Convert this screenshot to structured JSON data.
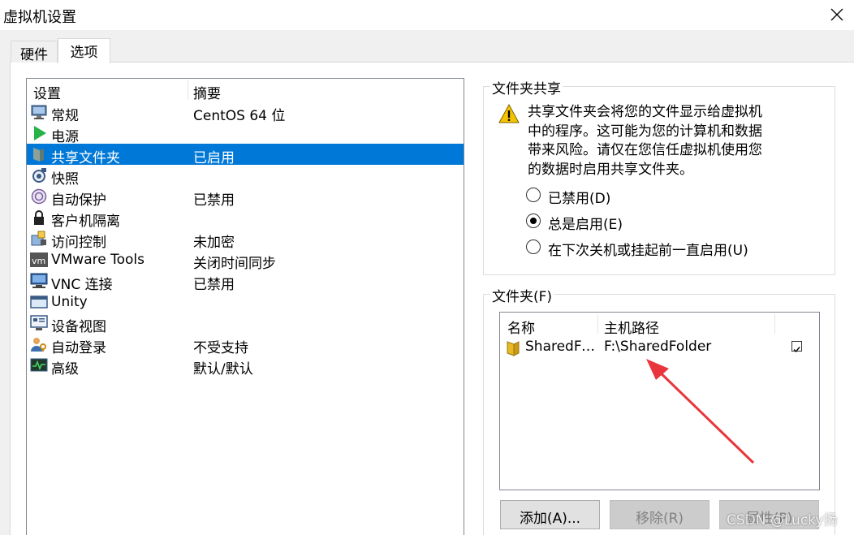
{
  "window": {
    "title": "虚拟机设置"
  },
  "tabs": [
    {
      "label": "硬件"
    },
    {
      "label": "选项"
    }
  ],
  "list": {
    "headers": {
      "setting": "设置",
      "summary": "摘要"
    },
    "items": [
      {
        "name": "常规",
        "summary": "CentOS 64 位",
        "icon": "monitor-icon"
      },
      {
        "name": "电源",
        "summary": "",
        "icon": "play-icon"
      },
      {
        "name": "共享文件夹",
        "summary": "已启用",
        "icon": "shared-folder-icon",
        "selected": true
      },
      {
        "name": "快照",
        "summary": "",
        "icon": "snapshot-icon"
      },
      {
        "name": "自动保护",
        "summary": "已禁用",
        "icon": "autoprotect-icon"
      },
      {
        "name": "客户机隔离",
        "summary": "",
        "icon": "lock-icon"
      },
      {
        "name": "访问控制",
        "summary": "未加密",
        "icon": "access-control-icon"
      },
      {
        "name": "VMware Tools",
        "summary": "关闭时间同步",
        "icon": "vmware-tools-icon"
      },
      {
        "name": "VNC 连接",
        "summary": "已禁用",
        "icon": "vnc-icon"
      },
      {
        "name": "Unity",
        "summary": "",
        "icon": "unity-icon"
      },
      {
        "name": "设备视图",
        "summary": "",
        "icon": "device-view-icon"
      },
      {
        "name": "自动登录",
        "summary": "不受支持",
        "icon": "autologin-icon"
      },
      {
        "name": "高级",
        "summary": "默认/默认",
        "icon": "advanced-icon"
      }
    ]
  },
  "sharing": {
    "legend": "文件夹共享",
    "warning_lines": [
      "共享文件夹会将您的文件显示给虚拟机",
      "中的程序。这可能为您的计算机和数据",
      "带来风险。请仅在您信任虚拟机使用您",
      "的数据时启用共享文件夹。"
    ],
    "options": [
      {
        "label": "已禁用(D)",
        "checked": false
      },
      {
        "label": "总是启用(E)",
        "checked": true
      },
      {
        "label": "在下次关机或挂起前一直启用(U)",
        "checked": false
      }
    ]
  },
  "folders": {
    "legend": "文件夹(F)",
    "headers": {
      "name": "名称",
      "path": "主机路径"
    },
    "rows": [
      {
        "name": "SharedFolder",
        "path": "F:\\SharedFolder",
        "enabled": true
      }
    ],
    "buttons": {
      "add": "添加(A)...",
      "remove": "移除(R)",
      "properties": "属性(P)"
    }
  },
  "watermark": "CSDN @Lucky扬",
  "colors": {
    "selection": "#0078d7",
    "arrow": "#e8363c"
  }
}
